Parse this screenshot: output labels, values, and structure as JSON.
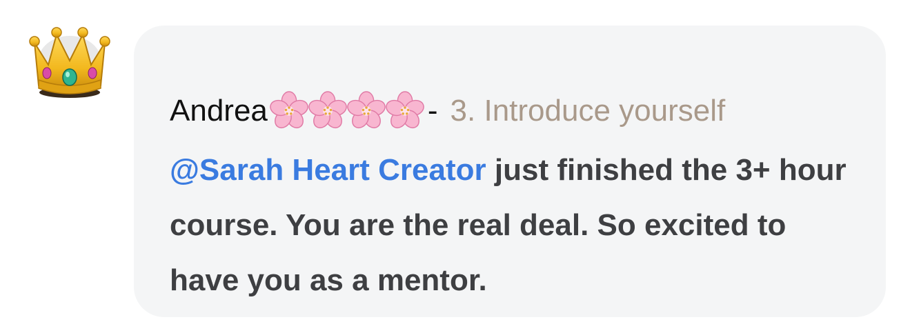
{
  "comment": {
    "avatar_icon": "crown-emoji-icon",
    "author": "Andrea",
    "author_decoration_icon": "cherry-blossom-icon",
    "author_decoration_count": 4,
    "separator": "-",
    "topic": "3. Introduce yourself",
    "mention": "@Sarah Heart Creator",
    "body": " just finished the 3+ hour course. You are the real deal. So excited to have you as a mentor."
  },
  "colors": {
    "bubble_background": "#f4f5f6",
    "topic_text": "#a9998a",
    "mention_link": "#3a7be0",
    "body_text": "#3e3f42",
    "crown_gold": "#f2b81e"
  }
}
